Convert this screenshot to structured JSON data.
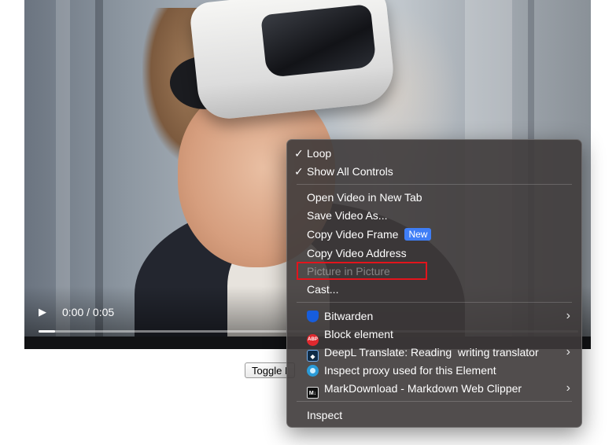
{
  "video": {
    "time_display": "0:00 / 0:05",
    "progress": 0.03,
    "play_icon": "play-icon"
  },
  "toggle_button": {
    "label": "Toggle I"
  },
  "context_menu": {
    "loop": {
      "label": "Loop",
      "checked": true
    },
    "show_all_controls": {
      "label": "Show All Controls",
      "checked": true
    },
    "open_in_new_tab": "Open Video in New Tab",
    "save_video_as": "Save Video As...",
    "copy_video_frame": "Copy Video Frame",
    "new_badge": "New",
    "copy_video_address": "Copy Video Address",
    "picture_in_picture": {
      "label": "Picture in Picture",
      "disabled": true
    },
    "cast": "Cast...",
    "extensions": [
      {
        "label": "Bitwarden",
        "icon": "bitwarden-icon",
        "submenu": true
      },
      {
        "label": "Block element",
        "icon": "adblock-icon",
        "submenu": false
      },
      {
        "label": "DeepL Translate: Reading  writing translator",
        "icon": "deepl-icon",
        "submenu": true
      },
      {
        "label": "Inspect proxy used for this Element",
        "icon": "proxy-icon",
        "submenu": false
      },
      {
        "label": "MarkDownload - Markdown Web Clipper",
        "icon": "markdown-icon",
        "submenu": true
      }
    ],
    "icon_text": {
      "abp": "ABP",
      "deepl": "◆",
      "markdown": "M↓"
    },
    "inspect": "Inspect"
  },
  "colors": {
    "menu_background": "#3e3a3a",
    "new_badge": "#3f7ef6",
    "highlight_border": "#e3141c"
  }
}
